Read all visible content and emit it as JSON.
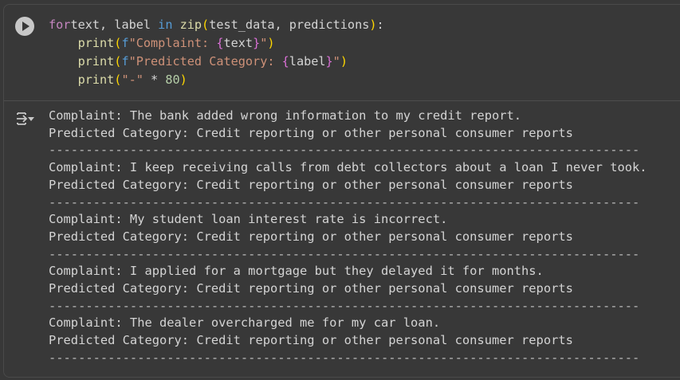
{
  "code": {
    "lines": [
      [
        [
          "kw",
          "for"
        ],
        [
          "",
          "text, label "
        ],
        [
          "kw2",
          "in"
        ],
        [
          "",
          ""
        ],
        [
          "fn",
          " zip"
        ],
        [
          "p",
          "("
        ],
        [
          "",
          "test_data, predictions"
        ],
        [
          "p",
          ")"
        ],
        [
          "",
          ":"
        ]
      ],
      [
        [
          "",
          "    "
        ],
        [
          "fn",
          "print"
        ],
        [
          "p",
          "("
        ],
        [
          "f",
          "f"
        ],
        [
          "s",
          "\"Complaint: "
        ],
        [
          "br",
          "{"
        ],
        [
          "",
          "text"
        ],
        [
          "br",
          "}"
        ],
        [
          "s",
          "\""
        ],
        [
          "p",
          ")"
        ]
      ],
      [
        [
          "",
          "    "
        ],
        [
          "fn",
          "print"
        ],
        [
          "p",
          "("
        ],
        [
          "f",
          "f"
        ],
        [
          "s",
          "\"Predicted Category: "
        ],
        [
          "br",
          "{"
        ],
        [
          "",
          "label"
        ],
        [
          "br",
          "}"
        ],
        [
          "s",
          "\""
        ],
        [
          "p",
          ")"
        ]
      ],
      [
        [
          "",
          "    "
        ],
        [
          "fn",
          "print"
        ],
        [
          "p",
          "("
        ],
        [
          "s",
          "\"-\""
        ],
        [
          "",
          " * "
        ],
        [
          "n",
          "80"
        ],
        [
          "p",
          ")"
        ]
      ]
    ]
  },
  "output": {
    "entries": [
      {
        "complaint": "Complaint: The bank added wrong information to my credit report.",
        "category": "Predicted Category: Credit reporting or other personal consumer reports"
      },
      {
        "complaint": "Complaint: I keep receiving calls from debt collectors about a loan I never took.",
        "category": "Predicted Category: Credit reporting or other personal consumer reports"
      },
      {
        "complaint": "Complaint: My student loan interest rate is incorrect.",
        "category": "Predicted Category: Credit reporting or other personal consumer reports"
      },
      {
        "complaint": "Complaint: I applied for a mortgage but they delayed it for months.",
        "category": "Predicted Category: Credit reporting or other personal consumer reports"
      },
      {
        "complaint": "Complaint: The dealer overcharged me for my car loan.",
        "category": "Predicted Category: Credit reporting or other personal consumer reports"
      }
    ],
    "separator": "--------------------------------------------------------------------------------"
  }
}
